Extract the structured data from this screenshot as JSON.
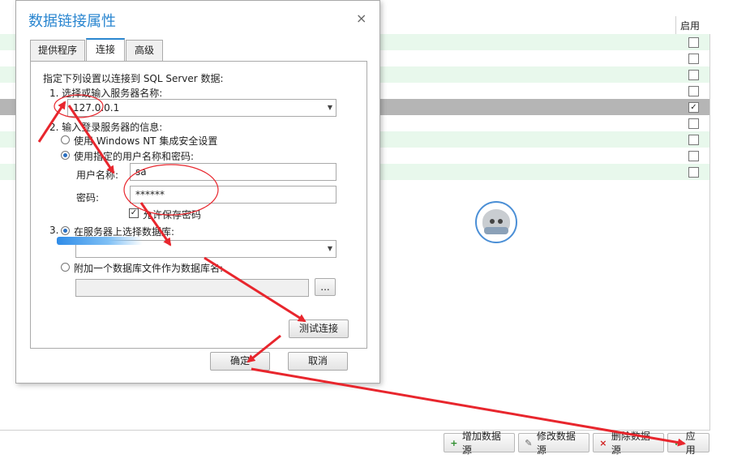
{
  "background": {
    "column_header": "启用",
    "rows": [
      {
        "style": "green",
        "checked": false
      },
      {
        "style": "white",
        "checked": false
      },
      {
        "style": "green",
        "checked": false
      },
      {
        "style": "white",
        "checked": false
      },
      {
        "style": "selected",
        "checked": true
      },
      {
        "style": "white",
        "checked": false
      },
      {
        "style": "green",
        "checked": false
      },
      {
        "style": "white",
        "checked": false
      },
      {
        "style": "green",
        "checked": false
      }
    ],
    "check_mark": "✓"
  },
  "bottom_toolbar": {
    "add_label": "增加数据源",
    "edit_label": "修改数据源",
    "delete_label": "删除数据源",
    "apply_label": "应用"
  },
  "dialog": {
    "title": "数据链接属性",
    "close_glyph": "×",
    "tabs": [
      "提供程序",
      "连接",
      "高级"
    ],
    "active_tab": "连接",
    "instructions": "指定下列设置以连接到 SQL Server 数据:",
    "step1_label": "1. 选择或输入服务器名称:",
    "server_value": "127.0.0.1",
    "step2_label": "2. 输入登录服务器的信息:",
    "radio_windows_nt": "使用 Windows NT 集成安全设置",
    "radio_specific_user": "使用指定的用户名称和密码:",
    "username_label": "用户名称:",
    "username_value": "sa",
    "password_label": "密码:",
    "password_value": "******",
    "allow_save_password": "允许保存密码",
    "step3_radio_label": "在服务器上选择数据库:",
    "step3_number": "3.",
    "attach_db_label": "附加一个数据库文件作为数据库名:",
    "browse_label": "...",
    "test_connection": "测试连接",
    "ok": "确定",
    "cancel": "取消"
  },
  "colors": {
    "accent": "#2a86d0",
    "annotation_red": "#e8262d",
    "row_green": "#e8f8ec",
    "row_selected": "#b5b5b5"
  }
}
